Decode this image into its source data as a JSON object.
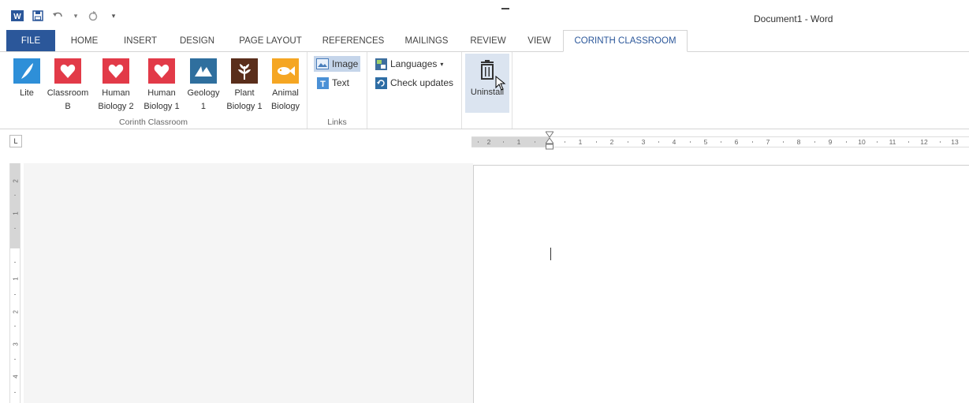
{
  "window": {
    "title": "Document1 - Word"
  },
  "qat": {
    "undo_arrow": "▾",
    "customize": "▾"
  },
  "tabs": [
    {
      "label": "FILE"
    },
    {
      "label": "HOME"
    },
    {
      "label": "INSERT"
    },
    {
      "label": "DESIGN"
    },
    {
      "label": "PAGE LAYOUT"
    },
    {
      "label": "REFERENCES"
    },
    {
      "label": "MAILINGS"
    },
    {
      "label": "REVIEW"
    },
    {
      "label": "VIEW"
    },
    {
      "label": "CORINTH CLASSROOM"
    }
  ],
  "ribbon": {
    "corinth_group": {
      "label": "Corinth Classroom",
      "buttons": [
        {
          "label": "Lite",
          "icon": "feather-icon",
          "color": "#2e8fd8"
        },
        {
          "label": "Classroom\nB",
          "icon": "heart-icon",
          "color": "#e23a48"
        },
        {
          "label": "Human\nBiology 2",
          "icon": "heart-icon",
          "color": "#e23a48"
        },
        {
          "label": "Human\nBiology 1",
          "icon": "heart-icon",
          "color": "#e23a48"
        },
        {
          "label": "Geology\n1",
          "icon": "mountain-icon",
          "color": "#2f6f9e"
        },
        {
          "label": "Plant\nBiology 1",
          "icon": "plant-icon",
          "color": "#5a2e1b"
        },
        {
          "label": "Animal\nBiology",
          "icon": "fish-icon",
          "color": "#f5a623"
        }
      ]
    },
    "links_group": {
      "label": "Links",
      "image_label": "Image",
      "text_label": "Text"
    },
    "misc_group": {
      "languages_label": "Languages",
      "languages_arrow": "▾",
      "check_updates_label": "Check updates"
    },
    "uninstall_group": {
      "uninstall_label": "Uninstall"
    }
  },
  "ruler": {
    "tab_selector": "L",
    "h_ticks": [
      "2",
      "1",
      "1",
      "2",
      "3",
      "4",
      "5",
      "6",
      "7",
      "8",
      "9",
      "10",
      "11",
      "12",
      "13"
    ],
    "v_ticks": [
      "2",
      "1",
      "1",
      "2",
      "3",
      "4"
    ]
  },
  "colors": {
    "file_tab": "#2b579a",
    "active_tab_text": "#2b579a",
    "selected_button": "#c5d5ea"
  }
}
